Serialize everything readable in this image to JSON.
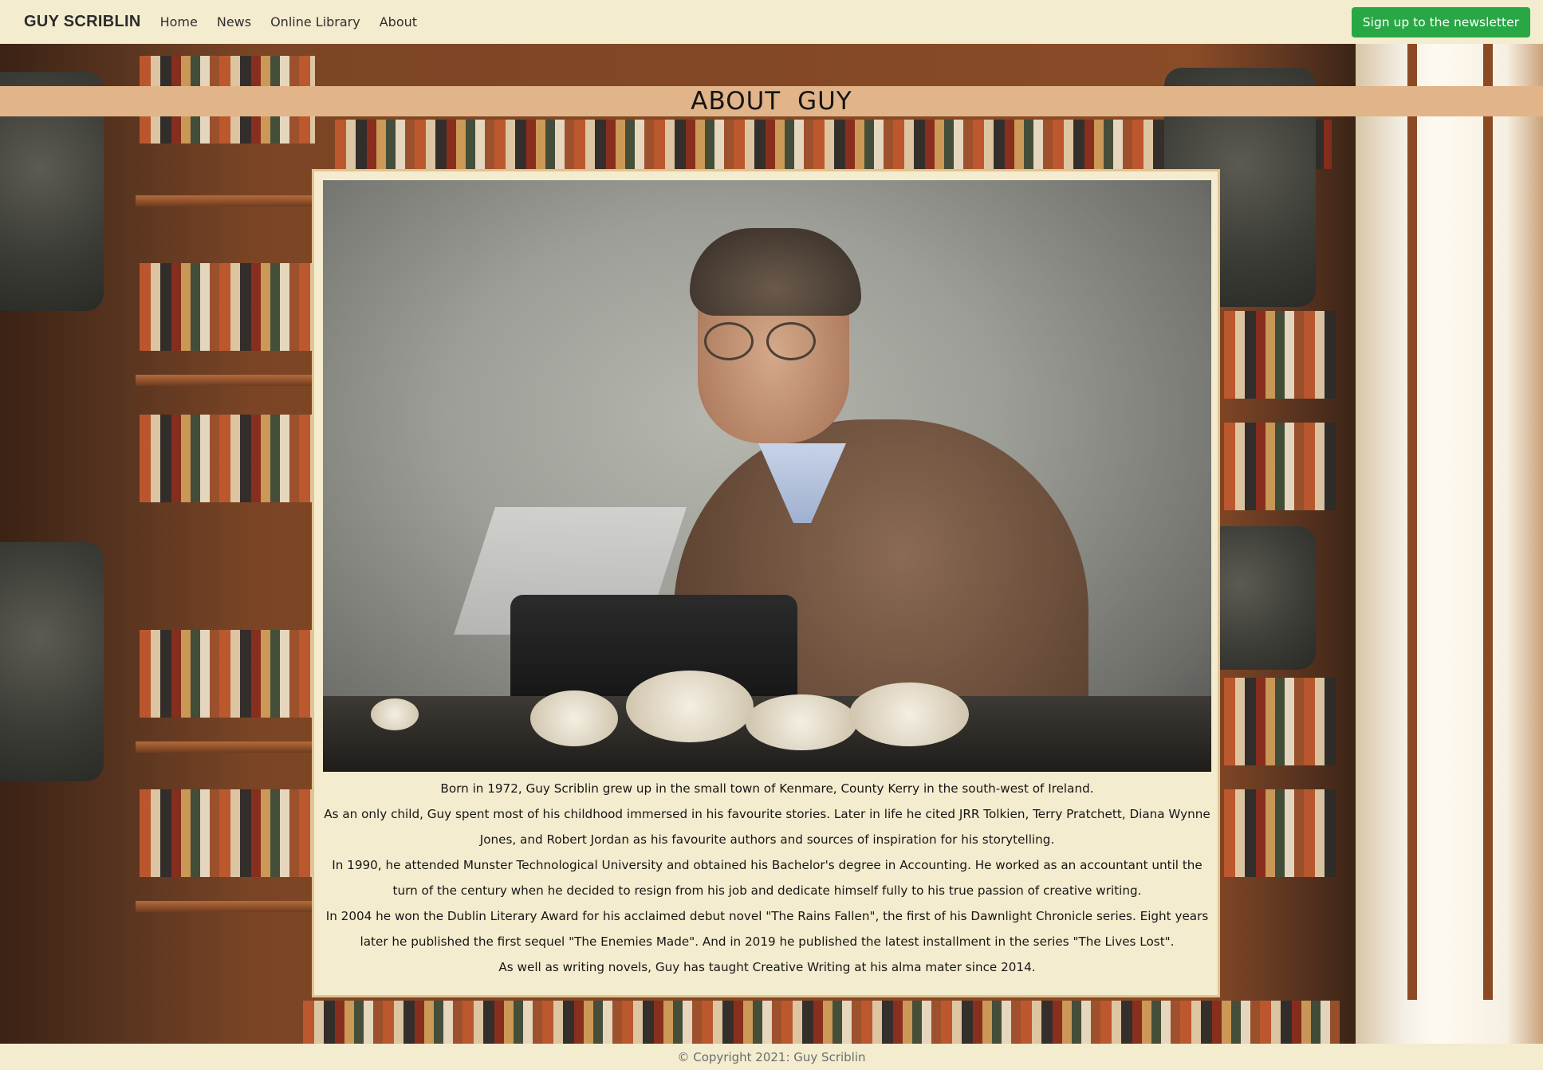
{
  "navbar": {
    "brand": "GUY SCRIBLIN",
    "links": [
      "Home",
      "News",
      "Online Library",
      "About"
    ],
    "cta_label": "Sign up to the newsletter",
    "cta_color": "#28a745"
  },
  "heading": {
    "title": "ABOUT  GUY"
  },
  "content": {
    "photo_icon": "author-photo",
    "paragraphs": [
      "Born in 1972, Guy Scriblin grew up in the small town of Kenmare, County Kerry in the south-west of Ireland.",
      "As an only child, Guy spent most of his childhood immersed in his favourite stories. Later in life he cited JRR Tolkien, Terry Pratchett, Diana Wynne Jones, and Robert Jordan as his favourite authors and sources of inspiration for his storytelling.",
      "In 1990, he attended Munster Technological University and obtained his Bachelor's degree in Accounting. He worked as an accountant until the turn of the century when he decided to resign from his job and dedicate himself fully to his true passion of creative writing.",
      "In 2004 he won the Dublin Literary Award for his acclaimed debut novel \"The Rains Fallen\", the first of his Dawnlight Chronicle series. Eight years later he published the first sequel \"The Enemies Made\". And in 2019 he published the latest installment in the series \"The Lives Lost\".",
      "As well as writing novels, Guy has taught Creative Writing at his alma mater since 2014."
    ]
  },
  "footer": {
    "copyright": "© Copyright 2021: Guy Scriblin"
  },
  "colors": {
    "navbar_bg": "#f4ecce",
    "heading_band": "#e2b489",
    "card_bg": "#f4ecce",
    "card_border": "#e4c38f"
  }
}
